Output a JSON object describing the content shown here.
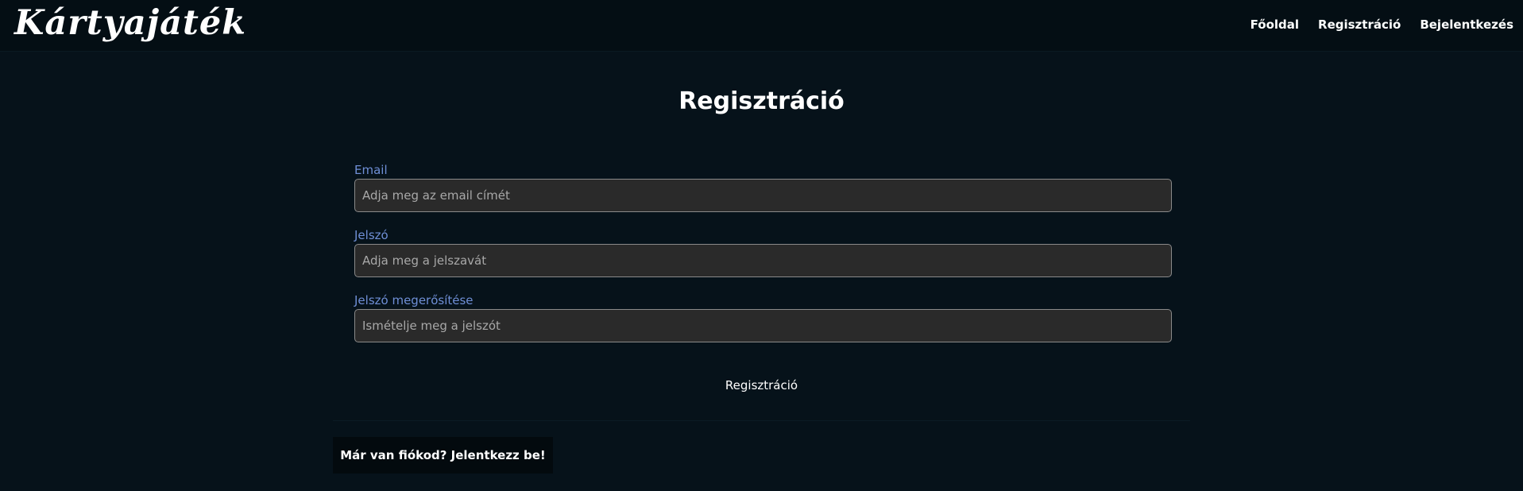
{
  "header": {
    "logo_text": "Kártyajáték",
    "nav": [
      {
        "label": "Főoldal"
      },
      {
        "label": "Regisztráció"
      },
      {
        "label": "Bejelentkezés"
      }
    ]
  },
  "main": {
    "title": "Regisztráció",
    "fields": {
      "email": {
        "label": "Email",
        "placeholder": "Adja meg az email címét",
        "value": ""
      },
      "password": {
        "label": "Jelszó",
        "placeholder": "Adja meg a jelszavát",
        "value": ""
      },
      "confirm": {
        "label": "Jelszó megerősítése",
        "placeholder": "Ismételje meg a jelszót",
        "value": ""
      }
    },
    "submit_label": "Regisztráció",
    "login_prompt": "Már van fiókod? Jelentkezz be!"
  },
  "colors": {
    "background": "#06121a",
    "navbar": "#040e14",
    "label": "#6f8fd6",
    "input_bg": "#2a2a2a",
    "text": "#ffffff"
  }
}
